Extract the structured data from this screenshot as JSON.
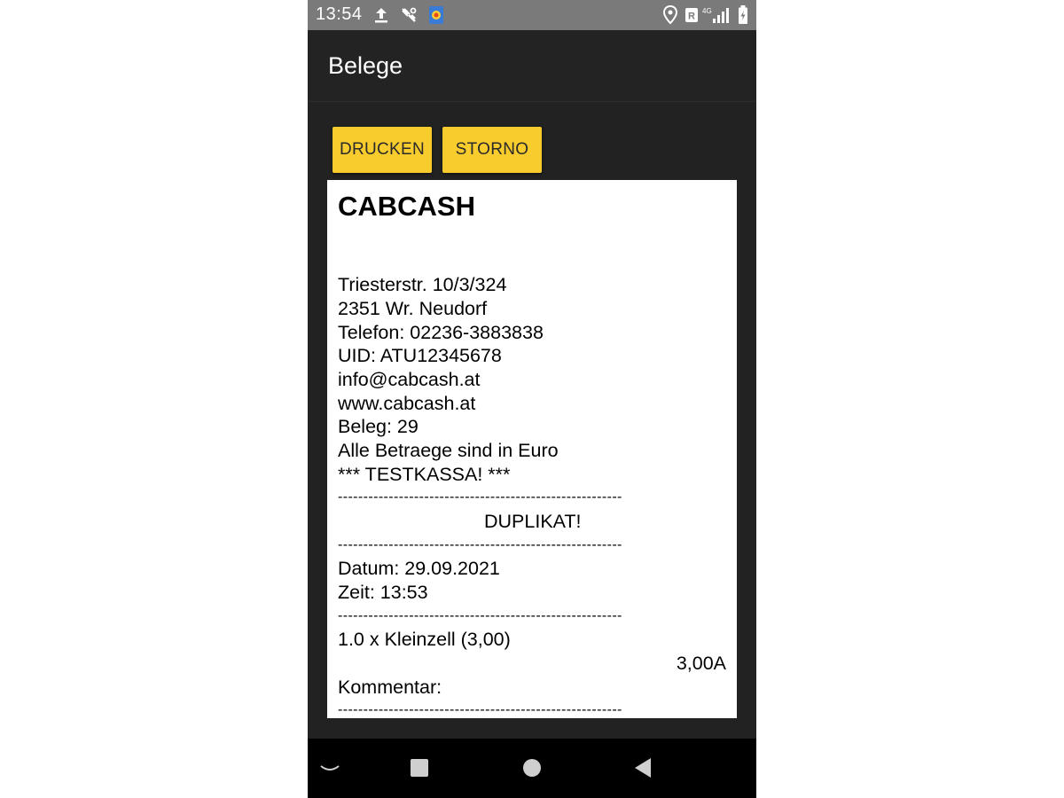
{
  "status_bar": {
    "time": "13:54",
    "network_label": "4G",
    "left_icons": [
      "upload-icon",
      "tools-icon",
      "app-notification-icon"
    ],
    "right_icons": [
      "location-icon",
      "roaming-icon",
      "signal-icon",
      "battery-icon"
    ]
  },
  "app_bar": {
    "title": "Belege"
  },
  "actions": {
    "print_label": "DRUCKEN",
    "cancel_label": "STORNO"
  },
  "receipt": {
    "company": "CABCASH",
    "address_street": "Triesterstr. 10/3/324",
    "address_city": "2351 Wr. Neudorf",
    "phone": "Telefon: 02236-3883838",
    "uid": "UID: ATU12345678",
    "email": "info@cabcash.at",
    "website": "www.cabcash.at",
    "receipt_no": "Beleg: 29",
    "currency_note": "Alle Betraege sind in Euro",
    "test_note": "*** TESTKASSA! ***",
    "separator": "--------------------------------------------------------",
    "duplicate": "DUPLIKAT!",
    "date": "Datum: 29.09.2021",
    "time": "Zeit: 13:53",
    "item_line": "1.0 x Kleinzell (3,00)",
    "item_total": "3,00A",
    "comment_label": "Kommentar:"
  },
  "nav_bar": {
    "icons": [
      "collapse-icon",
      "home-icon",
      "circle-home-icon",
      "back-icon"
    ]
  },
  "colors": {
    "accent": "#f9cc2e",
    "background": "#222222",
    "status_bar": "#7a7a7a"
  }
}
